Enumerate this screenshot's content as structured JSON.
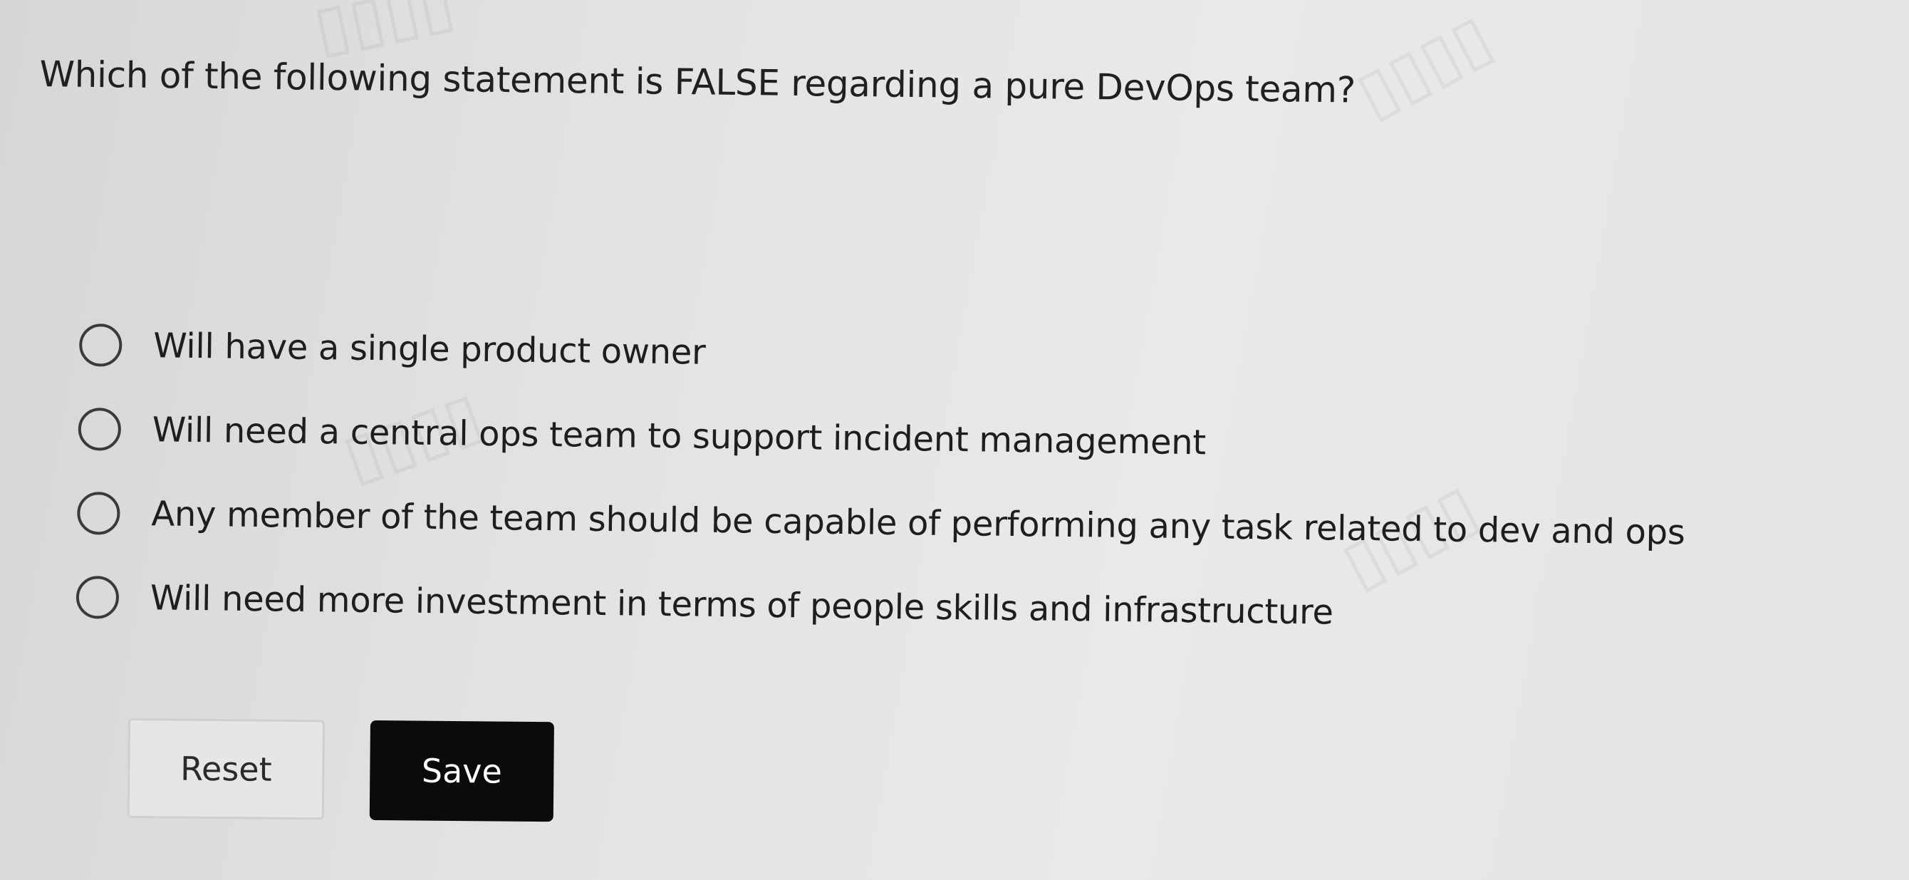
{
  "question": {
    "text": "Which of the following statement is FALSE regarding a pure DevOps team?"
  },
  "options": [
    {
      "label": "Will have a single product owner",
      "selected": false
    },
    {
      "label": "Will need a central ops team to support incident management",
      "selected": false
    },
    {
      "label": "Any member of the team should be capable of performing any task related to dev and ops",
      "selected": false
    },
    {
      "label": "Will need more investment in terms of people skills and infrastructure",
      "selected": false
    }
  ],
  "actions": {
    "reset_label": "Reset",
    "save_label": "Save"
  },
  "colors": {
    "save_background": "#0b0b0d",
    "save_text": "#ffffff",
    "reset_border": "#cfcfcd",
    "radio_border": "#3a3a3a"
  }
}
